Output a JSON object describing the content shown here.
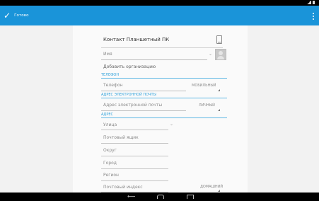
{
  "action_bar": {
    "done_label": "Готово"
  },
  "card": {
    "header_title": "Контакт Планшетный ПК"
  },
  "fields": {
    "name_placeholder": "Имя",
    "add_org": "Добавить организацию",
    "phone_section": "ТЕЛЕФОН",
    "phone_placeholder": "Телефон",
    "phone_type": "МОБИЛЬНЫЙ",
    "email_section": "АДРЕС ЭЛЕКТРОННОЙ ПОЧТЫ",
    "email_placeholder": "Адрес электронной почты",
    "email_type": "ЛИЧНЫЙ",
    "address_section": "АДРЕС",
    "street_placeholder": "Улица",
    "po_box_placeholder": "Почтовый ящик",
    "district_placeholder": "Округ",
    "city_placeholder": "Город",
    "region_placeholder": "Регион",
    "postal_placeholder": "Почтовый индекс",
    "address_type": "ДОМАШНИЙ"
  },
  "icons": {
    "done": "check-icon",
    "overflow": "overflow-menu-icon",
    "device": "tablet-icon",
    "expand": "chevron-down-icon",
    "avatar": "contact-photo-icon",
    "nav_back": "back-icon",
    "nav_home": "home-icon",
    "nav_recent": "recent-apps-icon"
  },
  "colors": {
    "action_bar": "#1a94d9",
    "section_header": "#33a3dc",
    "background": "#f2f2f2"
  }
}
